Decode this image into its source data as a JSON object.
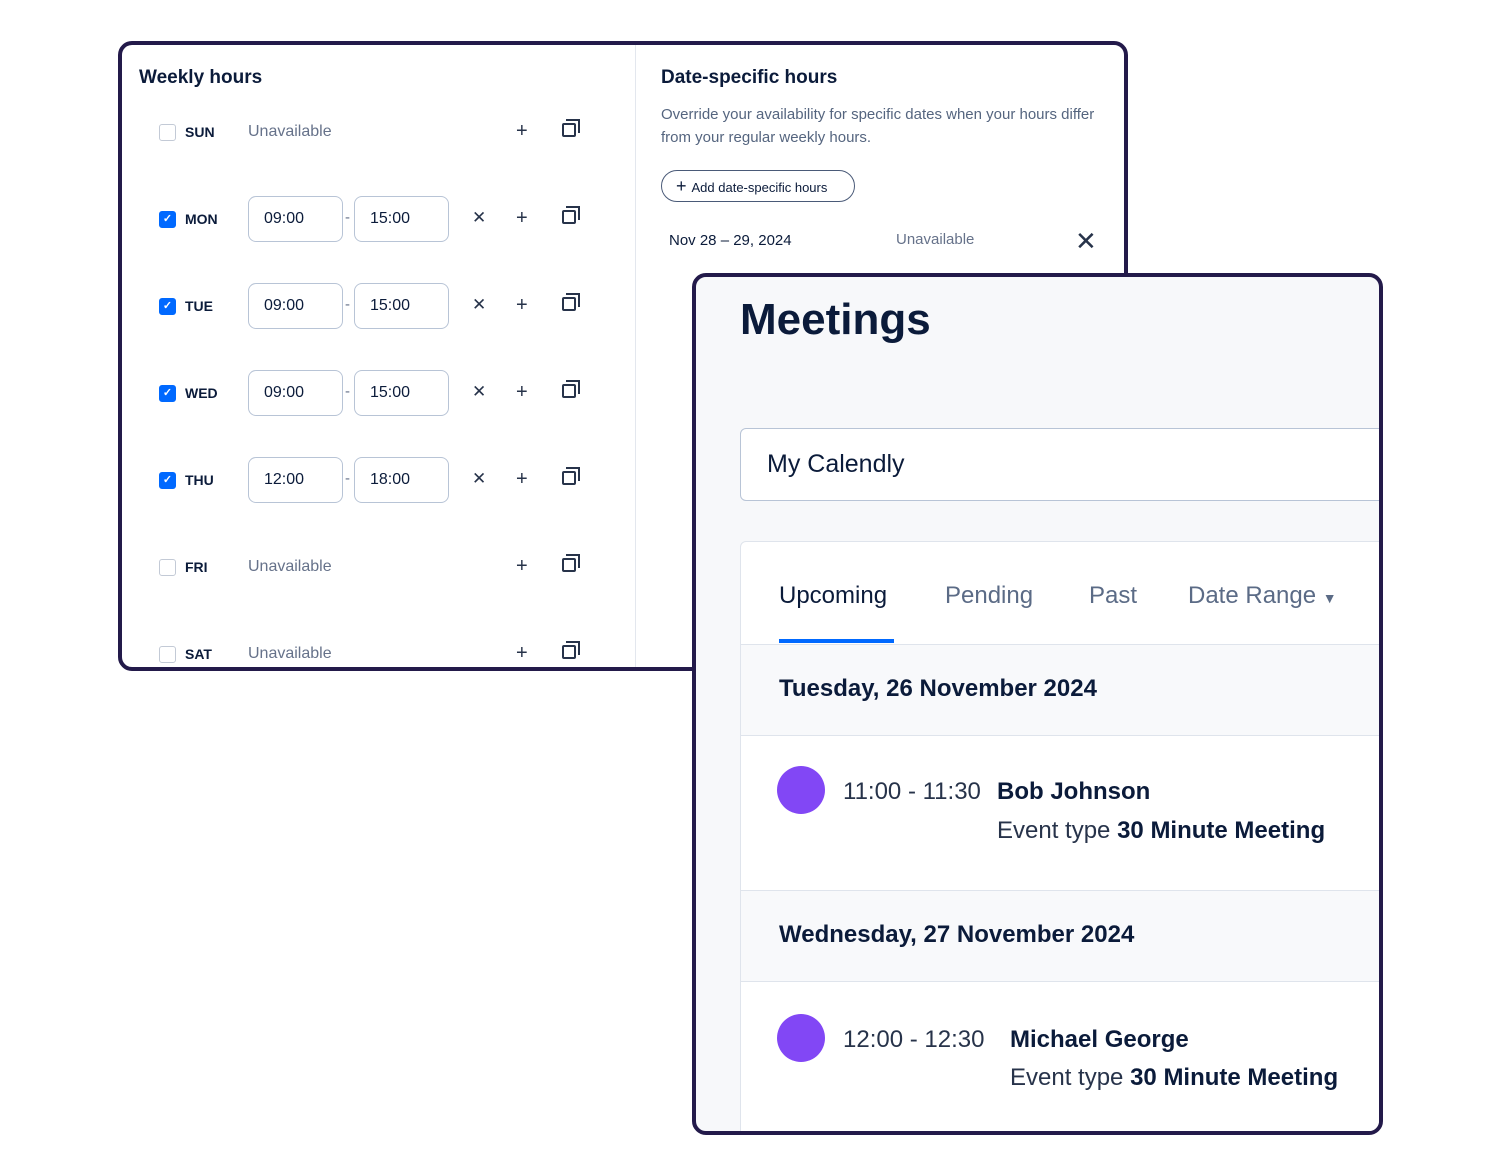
{
  "weekly": {
    "title": "Weekly hours",
    "days": [
      {
        "day": "SUN",
        "checked": false,
        "unavailable": "Unavailable"
      },
      {
        "day": "MON",
        "checked": true,
        "start": "09:00",
        "end": "15:00"
      },
      {
        "day": "TUE",
        "checked": true,
        "start": "09:00",
        "end": "15:00"
      },
      {
        "day": "WED",
        "checked": true,
        "start": "09:00",
        "end": "15:00"
      },
      {
        "day": "THU",
        "checked": true,
        "start": "12:00",
        "end": "18:00"
      },
      {
        "day": "FRI",
        "checked": false,
        "unavailable": "Unavailable"
      },
      {
        "day": "SAT",
        "checked": false,
        "unavailable": "Unavailable"
      }
    ]
  },
  "date_specific": {
    "title": "Date-specific hours",
    "description": "Override your availability for specific dates when your hours differ from your regular weekly hours.",
    "add_button": "Add date-specific hours",
    "overrides": [
      {
        "dates": "Nov 28 – 29, 2024",
        "status": "Unavailable"
      }
    ]
  },
  "meetings": {
    "title": "Meetings",
    "calendar": "My Calendly",
    "tabs": [
      "Upcoming",
      "Pending",
      "Past",
      "Date Range"
    ],
    "active_tab": "Upcoming",
    "groups": [
      {
        "date": "Tuesday, 26 November 2024",
        "events": [
          {
            "time": "11:00 - 11:30",
            "name": "Bob Johnson",
            "type_label": "Event type",
            "type": "30 Minute Meeting"
          }
        ]
      },
      {
        "date": "Wednesday, 27 November 2024",
        "events": [
          {
            "time": "12:00 - 12:30",
            "name": "Michael George",
            "type_label": "Event type",
            "type": "30 Minute Meeting"
          }
        ]
      }
    ],
    "event_color": "#8247f5",
    "accent": "#0069ff"
  }
}
